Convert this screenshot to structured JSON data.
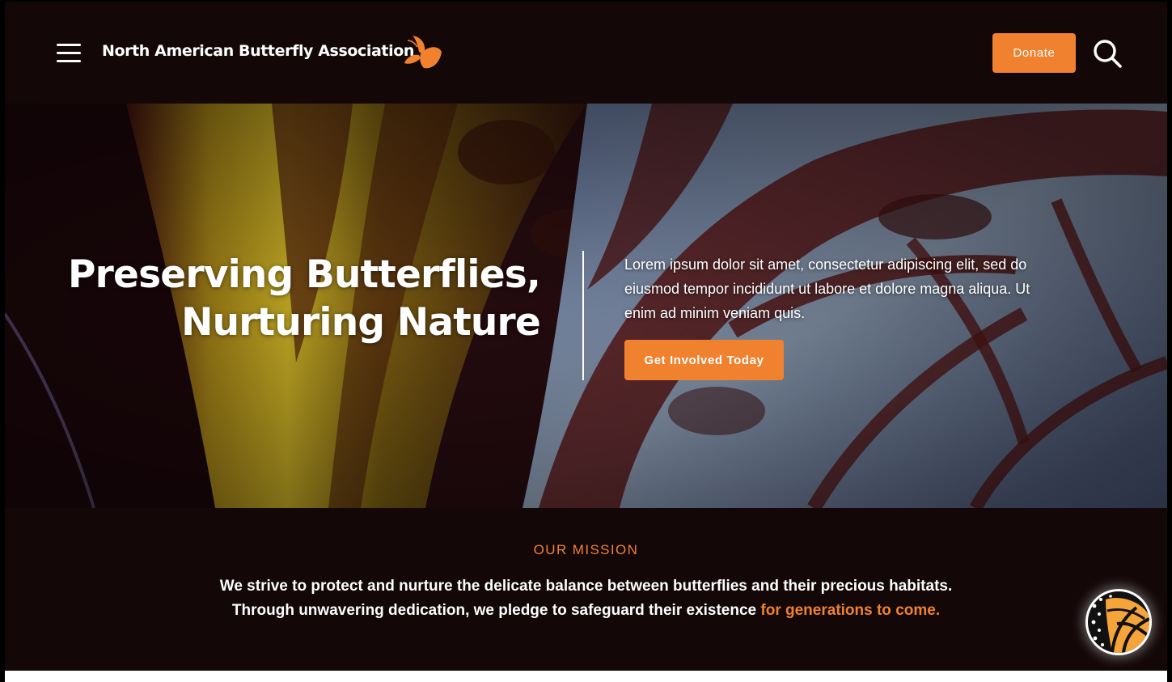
{
  "header": {
    "menu_icon": "hamburger-menu-icon",
    "brand_name": "North American Butterfly Association",
    "logo_icon": "butterfly-logo-icon",
    "donate_label": "Donate",
    "search_icon": "search-icon"
  },
  "hero": {
    "title_line1": "Preserving Butterflies,",
    "title_line2": "Nurturing Nature",
    "body": "Lorem ipsum dolor sit amet, consectetur adipiscing elit, sed do eiusmod tempor incididunt ut labore et dolore magna aliqua. Ut enim ad minim veniam quis.",
    "cta_label": "Get Involved Today"
  },
  "mission": {
    "heading": "OUR MISSION",
    "line1": "We strive to protect and nurture the delicate balance between butterflies and their precious habitats.",
    "line2": "Through unwavering dedication, we pledge to safeguard their existence",
    "line2_accent": "for generations to come."
  },
  "chat": {
    "icon": "monarch-wing-chat-icon"
  },
  "colors": {
    "accent": "#f0812f",
    "background": "#130708",
    "text": "#ffffff"
  }
}
